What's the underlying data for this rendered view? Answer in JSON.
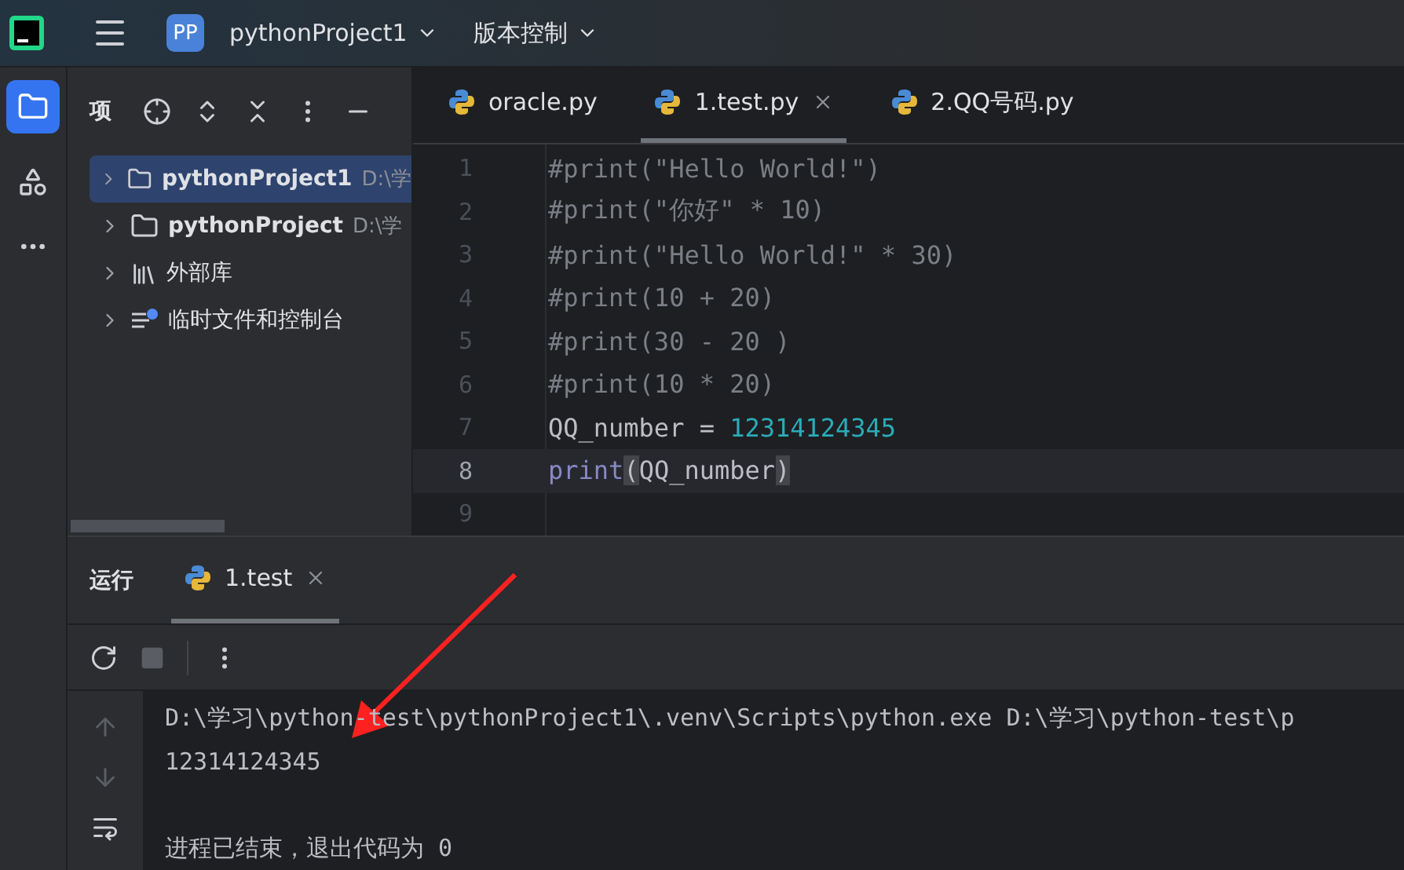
{
  "top_bar": {
    "project_badge": "PP",
    "project_name": "pythonProject1",
    "vcs_menu": "版本控制"
  },
  "side_tools": [
    {
      "kind": "project",
      "selected": true
    },
    {
      "kind": "structure",
      "selected": false
    }
  ],
  "project_panel": {
    "title": "项",
    "tree": [
      {
        "name": "pythonProject1",
        "path": "D:\\学",
        "kind": "folder",
        "selected": true
      },
      {
        "name": "pythonProject",
        "path": "D:\\学",
        "kind": "folder",
        "selected": false
      },
      {
        "name": "外部库",
        "kind": "library",
        "selected": false
      },
      {
        "name": "临时文件和控制台",
        "kind": "scratch",
        "selected": false
      }
    ]
  },
  "editor": {
    "tabs": [
      {
        "label": "oracle.py",
        "selected": false,
        "closable": false
      },
      {
        "label": "1.test.py",
        "selected": true,
        "closable": true
      },
      {
        "label": "2.QQ号码.py",
        "selected": false,
        "closable": false
      }
    ],
    "lines": [
      {
        "number": "1",
        "current": false,
        "tokens": [
          {
            "text": "#print(\"Hello World!\")",
            "kind": "comment"
          }
        ]
      },
      {
        "number": "2",
        "current": false,
        "tokens": [
          {
            "text": "#print(\"你好\" * 10)",
            "kind": "comment"
          }
        ]
      },
      {
        "number": "3",
        "current": false,
        "tokens": [
          {
            "text": "#print(\"Hello World!\" * 30)",
            "kind": "comment"
          }
        ]
      },
      {
        "number": "4",
        "current": false,
        "tokens": [
          {
            "text": "#print(10 + 20)",
            "kind": "comment"
          }
        ]
      },
      {
        "number": "5",
        "current": false,
        "tokens": [
          {
            "text": "#print(30 - 20 )",
            "kind": "comment"
          }
        ]
      },
      {
        "number": "6",
        "current": false,
        "tokens": [
          {
            "text": "#print(10 * 20)",
            "kind": "comment"
          }
        ]
      },
      {
        "number": "7",
        "current": false,
        "tokens": [
          {
            "text": "QQ_number = ",
            "kind": "plain"
          },
          {
            "text": "12314124345",
            "kind": "number"
          }
        ]
      },
      {
        "number": "8",
        "current": true,
        "tokens": [
          {
            "text": "print",
            "kind": "builtin"
          },
          {
            "text": "(",
            "kind": "brace"
          },
          {
            "text": "QQ_number",
            "kind": "plain"
          },
          {
            "text": ")",
            "kind": "brace"
          }
        ]
      },
      {
        "number": "9",
        "current": false
      }
    ]
  },
  "run_panel": {
    "title": "运行",
    "tabs": [
      {
        "label": "1.test",
        "selected": true
      }
    ],
    "output": [
      {
        "text": "D:\\学习\\python-test\\pythonProject1\\.venv\\Scripts\\python.exe D:\\学习\\python-test\\p",
        "spaced": false
      },
      {
        "text": "12314124345",
        "spaced": false
      },
      {
        "text": "进程已结束，退出代码为 0",
        "spaced": true
      }
    ]
  }
}
